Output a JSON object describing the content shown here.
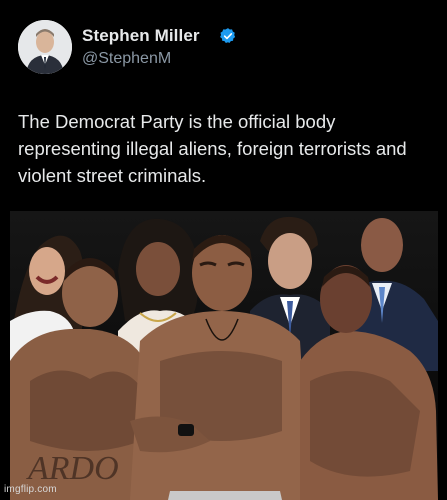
{
  "tweet": {
    "author_name": "Stephen Miller",
    "author_handle": "@StephenM",
    "verified": true,
    "text": "The Democrat Party is the official body representing illegal aliens, foreign terrorists and violent street criminals."
  },
  "icons": {
    "verified": "verified-badge-icon",
    "avatar": "profile-photo"
  },
  "media": {
    "tattoo_text": "ARDO",
    "watermark": "imgflip.com"
  },
  "colors": {
    "background": "#000000",
    "text_primary": "#e7e9ea",
    "text_secondary": "#8b98a5",
    "verified_blue": "#1d9bf0"
  }
}
